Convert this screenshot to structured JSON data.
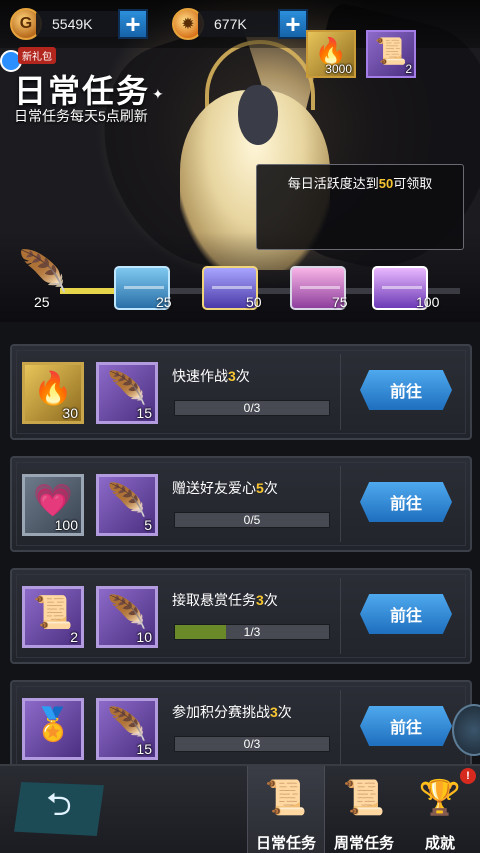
{
  "currency": {
    "gold_icon": "gold-coin-icon",
    "gold_amount": "5549K",
    "fire_icon": "flame-crystal-icon",
    "fire_amount": "677K",
    "add_symbol": "+"
  },
  "header": {
    "gift_label": "新礼包",
    "title": "日常任务",
    "subtitle": "日常任务每天5点刷新"
  },
  "reward_popup": {
    "prefix": "每日活跃度达到",
    "threshold": "50",
    "suffix": "可领取",
    "items": [
      {
        "icon": "flame-key-icon",
        "count": "3000",
        "color": "#e8c45a"
      },
      {
        "icon": "purple-scroll-icon",
        "count": "2",
        "color": "#8c6ac9"
      }
    ]
  },
  "activity": {
    "current_points": "25",
    "progress_fraction": 0.25,
    "milestones": [
      "25",
      "50",
      "75",
      "100"
    ]
  },
  "tasks": [
    {
      "name_prefix": "快速作战",
      "name_count": "3",
      "name_suffix": "次",
      "progress_text": "0/3",
      "progress_fraction": 0,
      "rewards": [
        {
          "icon": "flame-key-icon",
          "count": "30",
          "style": "gold"
        },
        {
          "icon": "feather-icon",
          "count": "15",
          "style": "purple"
        }
      ],
      "button": "前往"
    },
    {
      "name_prefix": "赠送好友爱心",
      "name_count": "5",
      "name_suffix": "次",
      "progress_text": "0/5",
      "progress_fraction": 0,
      "rewards": [
        {
          "icon": "heart-icon",
          "count": "100",
          "style": "grey"
        },
        {
          "icon": "feather-icon",
          "count": "5",
          "style": "purple"
        }
      ],
      "button": "前往"
    },
    {
      "name_prefix": "接取悬赏任务",
      "name_count": "3",
      "name_suffix": "次",
      "progress_text": "1/3",
      "progress_fraction": 0.333,
      "rewards": [
        {
          "icon": "purple-scroll-icon",
          "count": "2",
          "style": "purple"
        },
        {
          "icon": "feather-icon",
          "count": "10",
          "style": "purple"
        }
      ],
      "button": "前往"
    },
    {
      "name_prefix": "参加积分赛挑战",
      "name_count": "3",
      "name_suffix": "次",
      "progress_text": "0/3",
      "progress_fraction": 0,
      "rewards": [
        {
          "icon": "sword-medal-icon",
          "count": "",
          "style": "purple"
        },
        {
          "icon": "feather-icon",
          "count": "15",
          "style": "purple"
        }
      ],
      "button": "前往"
    }
  ],
  "bottom_nav": {
    "back_icon": "back-arrow-icon",
    "tabs": [
      {
        "label": "日常任务",
        "icon": "daily-scroll-icon",
        "active": true
      },
      {
        "label": "周常任务",
        "icon": "weekly-scroll-icon",
        "active": false
      },
      {
        "label": "成就",
        "icon": "trophy-icon",
        "active": false
      }
    ],
    "badge": "!"
  }
}
